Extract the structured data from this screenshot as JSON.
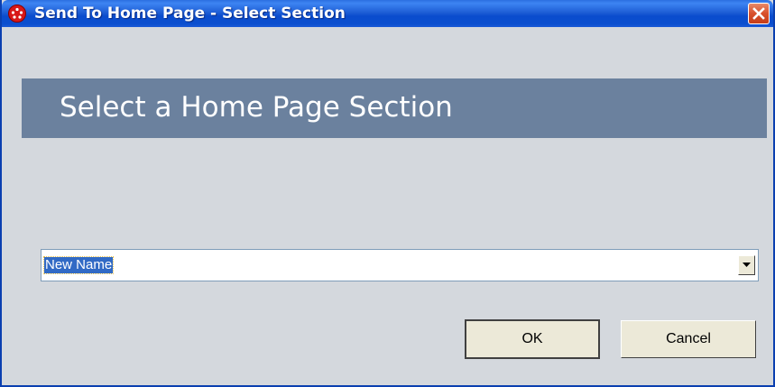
{
  "window": {
    "title": "Send To Home Page - Select Section",
    "icon": "red-dots-app-icon",
    "close_icon": "close-icon"
  },
  "header": {
    "title": "Select a Home Page Section",
    "band_color": "#6b819e"
  },
  "section_select": {
    "value": "New Name",
    "arrow_icon": "chevron-down-icon"
  },
  "buttons": {
    "ok_label": "OK",
    "cancel_label": "Cancel"
  },
  "colors": {
    "titlebar": "#0a4ccd",
    "selection": "#316ac5",
    "close_button": "#d8502c"
  }
}
